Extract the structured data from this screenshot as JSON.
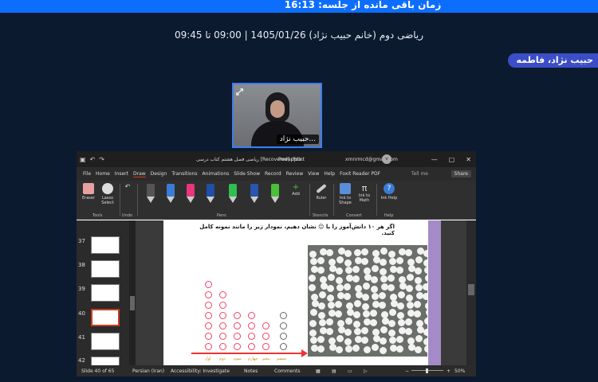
{
  "header": {
    "timer_text": "زمان باقی مانده از جلسه: 16:13"
  },
  "session": {
    "info": "ریاضی دوم (خانم حبیب نژاد) 1405/01/26 | 09:00 تا 09:45"
  },
  "participant_chip": {
    "name": "حبیب نژاد، فاطمه"
  },
  "video": {
    "label": "حبیب نژاد...",
    "expand_icon": "expand-icon"
  },
  "ppt": {
    "doc_title": "ریاضی فصل هشتم کتاب درسی [Recovered].pptx",
    "app_name": "PowerPoint",
    "email": "xmnrmcd@gmail.com",
    "avatar_letter": "v",
    "tabs": [
      "File",
      "Home",
      "Insert",
      "Draw",
      "Design",
      "Transitions",
      "Animations",
      "Slide Show",
      "Record",
      "Review",
      "View",
      "Help",
      "Foxit Reader PDF"
    ],
    "active_tab": "Draw",
    "tell_me": "Tell me",
    "share_label": "Share",
    "tools": {
      "eraser": "Eraser",
      "lasso": "Lasso Select",
      "add": "Add",
      "ruler": "Ruler",
      "ink_to_shape": "Ink to Shape",
      "ink_to_math": "Ink to Math",
      "ink_help": "Ink Help"
    },
    "groups": {
      "tools": "Tools",
      "undo": "Undo",
      "pens": "Pens",
      "stencils": "Stencils",
      "convert": "Convert",
      "help": "Help"
    },
    "slide_numbers": [
      "37",
      "38",
      "39",
      "40",
      "41",
      "42"
    ],
    "active_slide": "40",
    "slide_question": "اگر هر ۱۰ دانش‌آموز را با ☺ نشان دهیم، نمودار زیر را مانند نمونه کامل کنید.",
    "categories": [
      "اول",
      "دوم",
      "سوم",
      "چهارم",
      "پنجم",
      "ششم"
    ],
    "status": {
      "slide": "Slide 40 of 65",
      "language": "Persian (Iran)",
      "accessibility": "Accessibility: Investigate",
      "notes": "Notes",
      "comments": "Comments",
      "zoom": "50%"
    }
  }
}
